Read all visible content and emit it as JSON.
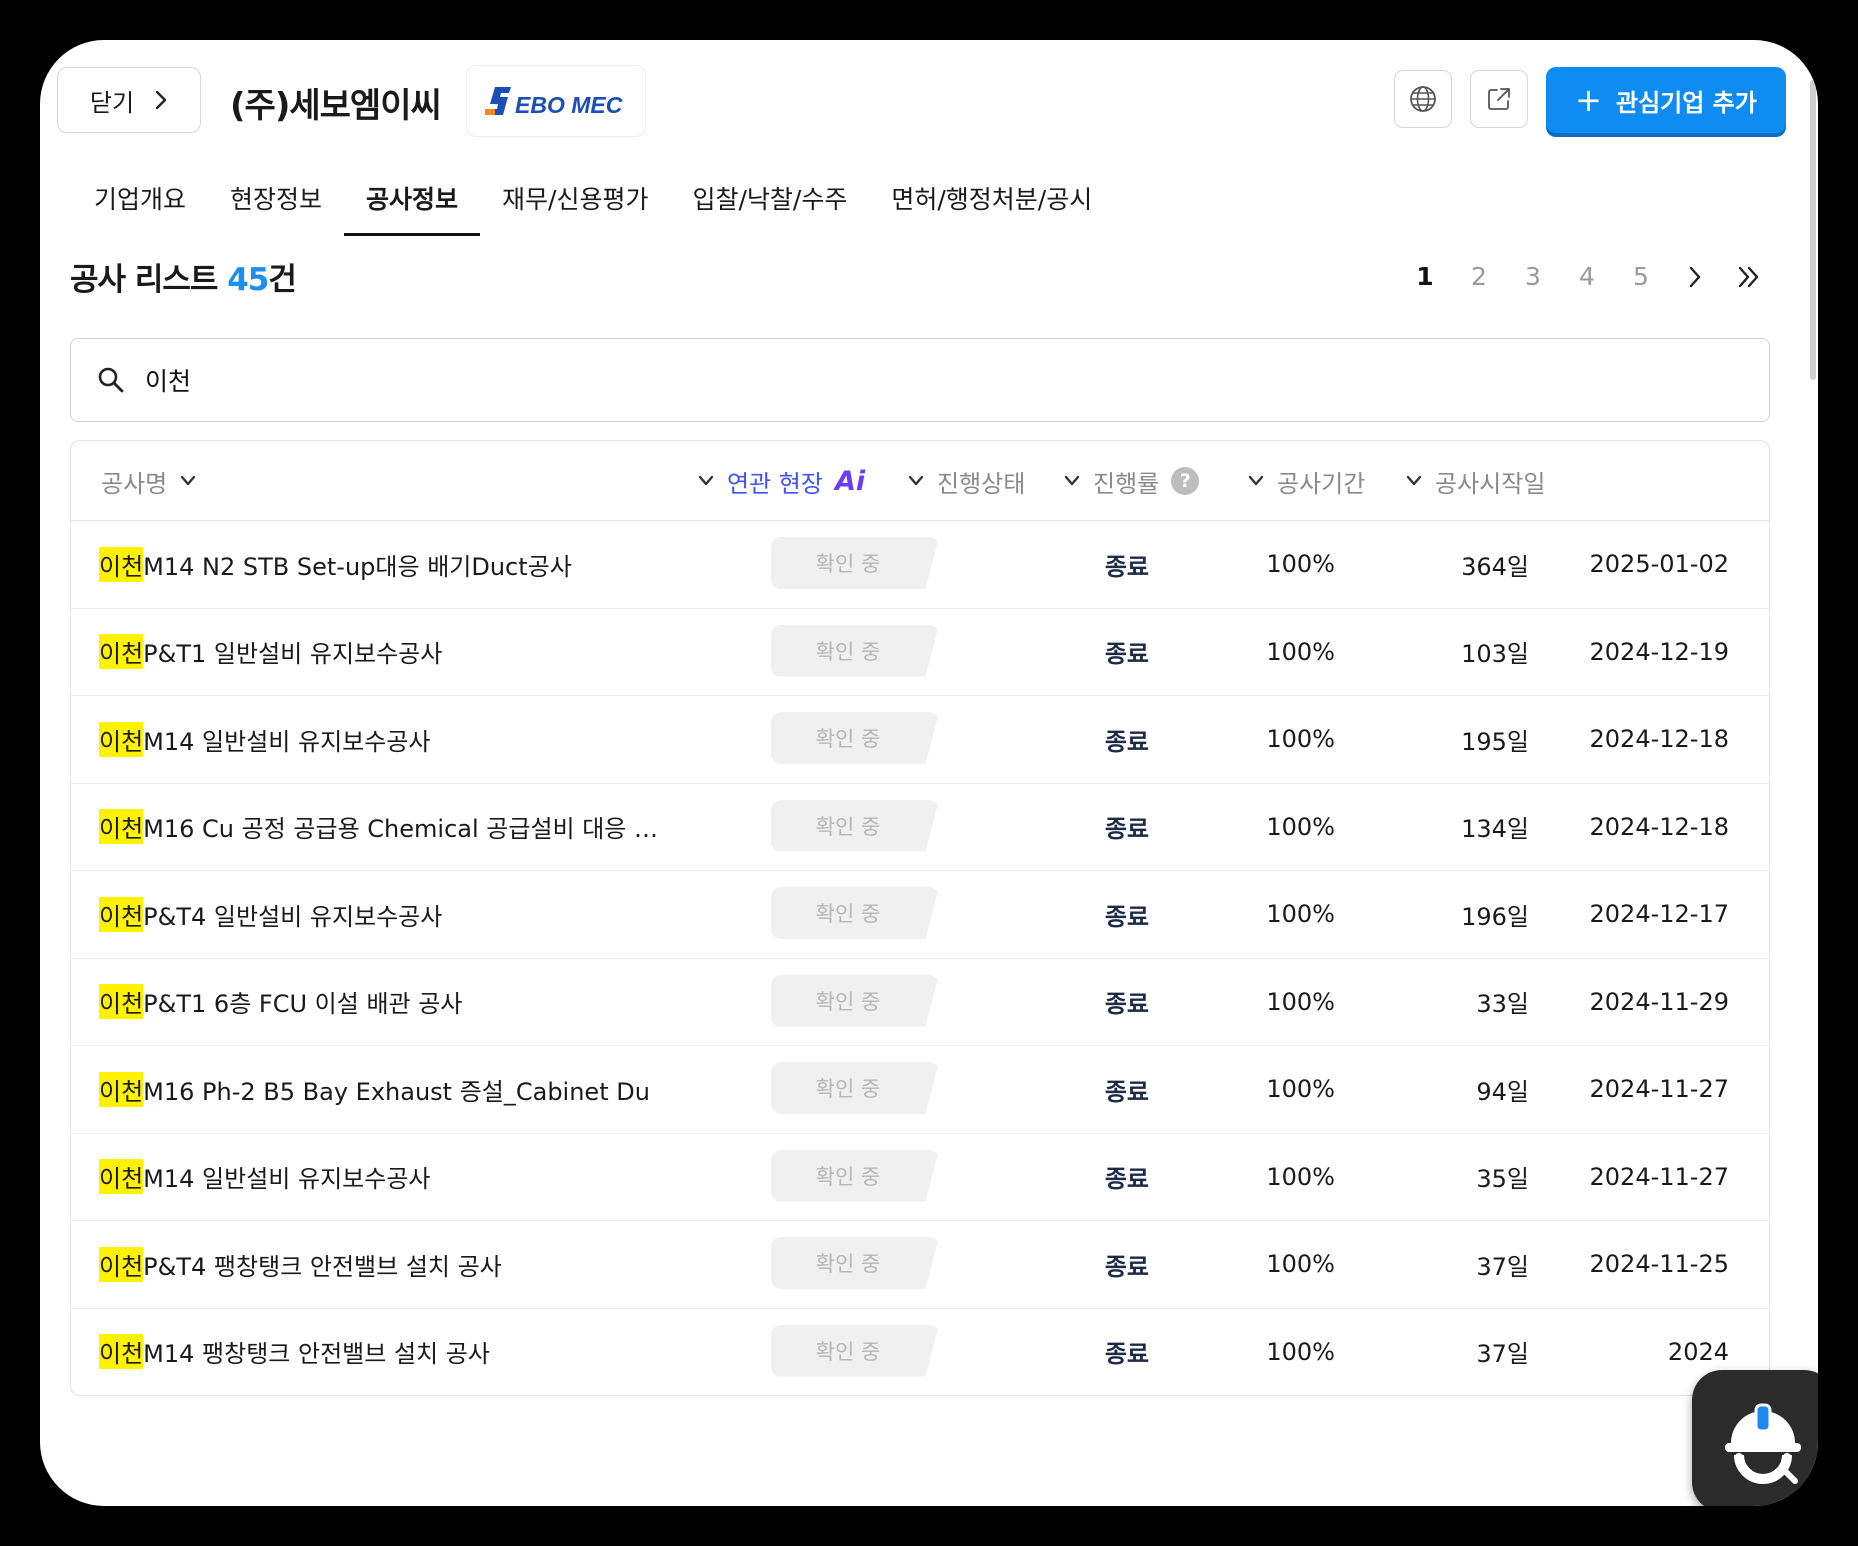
{
  "header": {
    "close_label": "닫기",
    "company_name": "(주)세보엠이씨",
    "logo_text": "SEBO MEC",
    "add_label": "관심기업 추가",
    "accent_color": "#0e8cf2"
  },
  "tabs": [
    {
      "label": "기업개요",
      "active": false
    },
    {
      "label": "현장정보",
      "active": false
    },
    {
      "label": "공사정보",
      "active": true
    },
    {
      "label": "재무/신용평가",
      "active": false
    },
    {
      "label": "입찰/낙찰/수주",
      "active": false
    },
    {
      "label": "면허/행정처분/공시",
      "active": false
    }
  ],
  "list": {
    "title": "공사 리스트",
    "count": "45",
    "count_suffix": "건"
  },
  "pagination": {
    "pages": [
      "1",
      "2",
      "3",
      "4",
      "5"
    ],
    "current": "1"
  },
  "search": {
    "value": "이천",
    "placeholder": ""
  },
  "table": {
    "columns": {
      "name": "공사명",
      "related": "연관 현장",
      "related_ai": "Ai",
      "status": "진행상태",
      "rate": "진행률",
      "rate_help": "?",
      "period": "공사기간",
      "start": "공사시작일"
    },
    "rows": [
      {
        "highlight": "이천",
        "name": "M14 N2 STB Set-up대응 배기Duct공사",
        "related": "확인 중",
        "status": "종료",
        "rate": "100%",
        "period": "364일",
        "start": "2025-01-02"
      },
      {
        "highlight": "이천",
        "name": "P&T1 일반설비 유지보수공사",
        "related": "확인 중",
        "status": "종료",
        "rate": "100%",
        "period": "103일",
        "start": "2024-12-19"
      },
      {
        "highlight": "이천",
        "name": "M14 일반설비 유지보수공사",
        "related": "확인 중",
        "status": "종료",
        "rate": "100%",
        "period": "195일",
        "start": "2024-12-18"
      },
      {
        "highlight": "이천",
        "name": "M16 Cu 공정 공급용 Chemical 공급설비 대응 …",
        "related": "확인 중",
        "status": "종료",
        "rate": "100%",
        "period": "134일",
        "start": "2024-12-18"
      },
      {
        "highlight": "이천",
        "name": "P&T4 일반설비 유지보수공사",
        "related": "확인 중",
        "status": "종료",
        "rate": "100%",
        "period": "196일",
        "start": "2024-12-17"
      },
      {
        "highlight": "이천",
        "name": "P&T1 6층 FCU 이설 배관 공사",
        "related": "확인 중",
        "status": "종료",
        "rate": "100%",
        "period": "33일",
        "start": "2024-11-29"
      },
      {
        "highlight": "이천",
        "name": "M16 Ph-2 B5 Bay Exhaust 증설_Cabinet Du",
        "related": "확인 중",
        "status": "종료",
        "rate": "100%",
        "period": "94일",
        "start": "2024-11-27"
      },
      {
        "highlight": "이천",
        "name": "M14 일반설비 유지보수공사",
        "related": "확인 중",
        "status": "종료",
        "rate": "100%",
        "period": "35일",
        "start": "2024-11-27"
      },
      {
        "highlight": "이천",
        "name": "P&T4 팽창탱크 안전밸브 설치 공사",
        "related": "확인 중",
        "status": "종료",
        "rate": "100%",
        "period": "37일",
        "start": "2024-11-25"
      },
      {
        "highlight": "이천",
        "name": "M14 팽창탱크 안전밸브 설치 공사",
        "related": "확인 중",
        "status": "종료",
        "rate": "100%",
        "period": "37일",
        "start": "2024"
      }
    ]
  },
  "icons": [
    "chevron-right-icon",
    "globe-icon",
    "external-link-icon",
    "plus-icon",
    "search-icon",
    "chevron-down-icon",
    "double-chevron-right-icon",
    "chatbot-helmet-icon"
  ]
}
